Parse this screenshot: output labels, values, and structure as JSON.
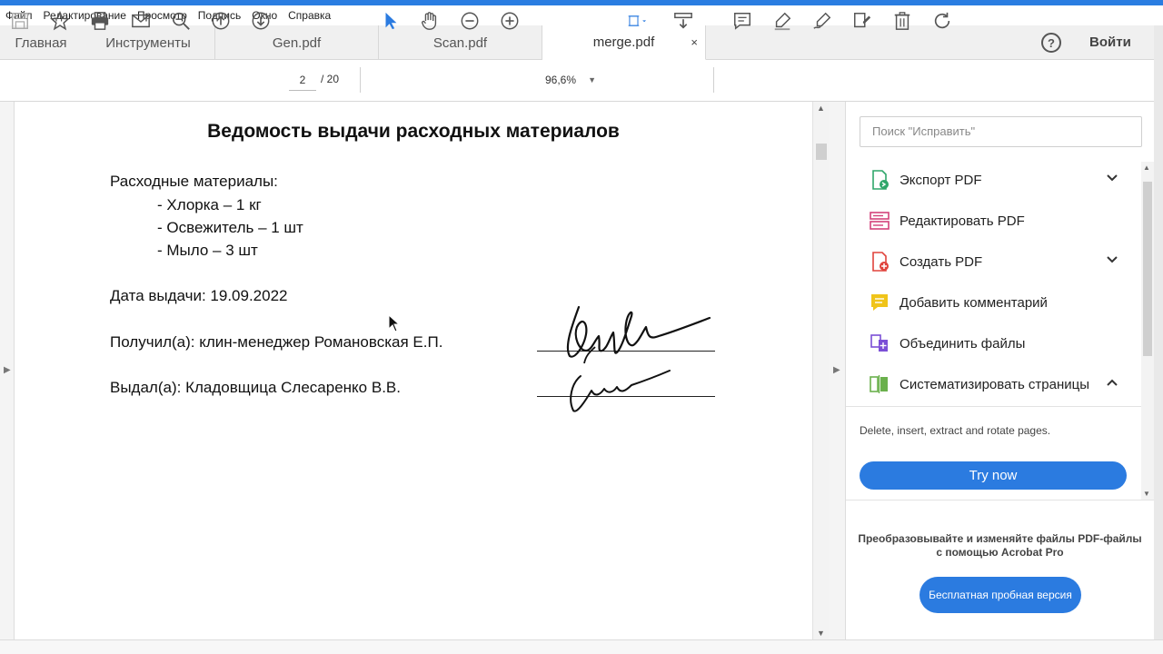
{
  "menu": [
    "Файл",
    "Редактирование",
    "Просмотр",
    "Подпись",
    "Окно",
    "Справка"
  ],
  "tabs": {
    "home": "Главная",
    "tools": "Инструменты",
    "files": [
      {
        "label": "Gen.pdf"
      },
      {
        "label": "Scan.pdf"
      },
      {
        "label": "merge.pdf",
        "close": "×"
      }
    ]
  },
  "header": {
    "help": "?",
    "login": "Войти"
  },
  "toolbar": {
    "page_current": "2",
    "page_total": "/ 20",
    "zoom": "96,6%",
    "icons": [
      "save-icon",
      "bookmark-star-icon",
      "print-icon",
      "email-icon",
      "zoom-search-icon",
      "page-up-icon",
      "page-down-icon",
      "select-cursor-icon",
      "hand-icon",
      "zoom-out-icon",
      "zoom-in-icon",
      "fit-page-icon",
      "scroll-mode-icon",
      "comment-icon",
      "highlight-icon",
      "sign-icon",
      "edit-icon",
      "delete-icon",
      "rotate-icon"
    ]
  },
  "document": {
    "title": "Ведомость выдачи расходных материалов",
    "materials_heading": "Расходные материалы:",
    "items": [
      "- Хлорка – 1 кг",
      "- Освежитель – 1 шт",
      "- Мыло – 3 шт"
    ],
    "date_line": "Дата выдачи: 19.09.2022",
    "received_line": "Получил(а): клин-менеджер Романовская Е.П.",
    "issued_line": "Выдал(а): Кладовщица Слесаренко В.В."
  },
  "panel": {
    "search_placeholder": "Поиск \"Исправить\"",
    "tools": [
      {
        "label": "Экспорт PDF",
        "icon": "export-pdf-icon",
        "color": "#2fa66a",
        "expandable": true
      },
      {
        "label": "Редактировать PDF",
        "icon": "edit-pdf-icon",
        "color": "#d3427b",
        "expandable": false
      },
      {
        "label": "Создать PDF",
        "icon": "create-pdf-icon",
        "color": "#e0433c",
        "expandable": true
      },
      {
        "label": "Добавить комментарий",
        "icon": "comment-tool-icon",
        "color": "#f0c419",
        "expandable": false
      },
      {
        "label": "Объединить файлы",
        "icon": "combine-files-icon",
        "color": "#7b4fd6",
        "expandable": false
      },
      {
        "label": "Систематизировать страницы",
        "icon": "organize-pages-icon",
        "color": "#6ab04c",
        "expandable": true
      }
    ],
    "description": "Delete, insert, extract and rotate pages.",
    "try_button": "Try now",
    "promo_text_1": "Преобразовывайте и изменяйте файлы PDF-файлы",
    "promo_text_2": "с помощью Acrobat Pro",
    "trial_button": "Бесплатная пробная версия"
  },
  "colors": {
    "accent": "#2b7be0",
    "tab_bg": "#f0f0f0"
  }
}
